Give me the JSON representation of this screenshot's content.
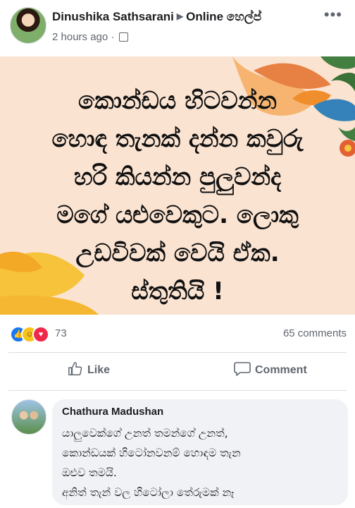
{
  "post": {
    "author": "Dinushika Sathsarani",
    "group": "Online හෙල්ප්",
    "time": "2 hours ago",
    "more": "•••",
    "banner_lines": [
      "කොන්ඩය හිටවන්න",
      "හොඳ තැනක් දන්න කවුරු",
      "හරි කියන්න පුලුවන්ද",
      "මගේ යළුවෙකුට. ලොකු",
      "උඩවිවක් වෙයි ඒක.",
      "ස්තුතියි !"
    ],
    "reaction_count": "73",
    "comments_count": "65 comments",
    "like_label": "Like",
    "comment_label": "Comment",
    "colors": {
      "banner_bg": "#fbe3d1",
      "accent": "#1877f2",
      "text": "#1c1e21",
      "muted": "#606770"
    }
  },
  "comment": {
    "author": "Chathura Madushan",
    "lines": [
      "යාලුවෙක්ගේ උනත් තමන්ගේ උනත්,",
      "කොන්ඩයක් හිටෝනවනම් හොඳම තැන",
      "ඔළුව තමයි.",
      "අනිත් තැන් වල හිටෝලා තේරුමක් නෑ"
    ]
  },
  "icons": [
    "globe-icon",
    "more-icon",
    "like-reaction-icon",
    "haha-reaction-icon",
    "love-reaction-icon",
    "thumbs-up-icon",
    "comment-icon"
  ]
}
